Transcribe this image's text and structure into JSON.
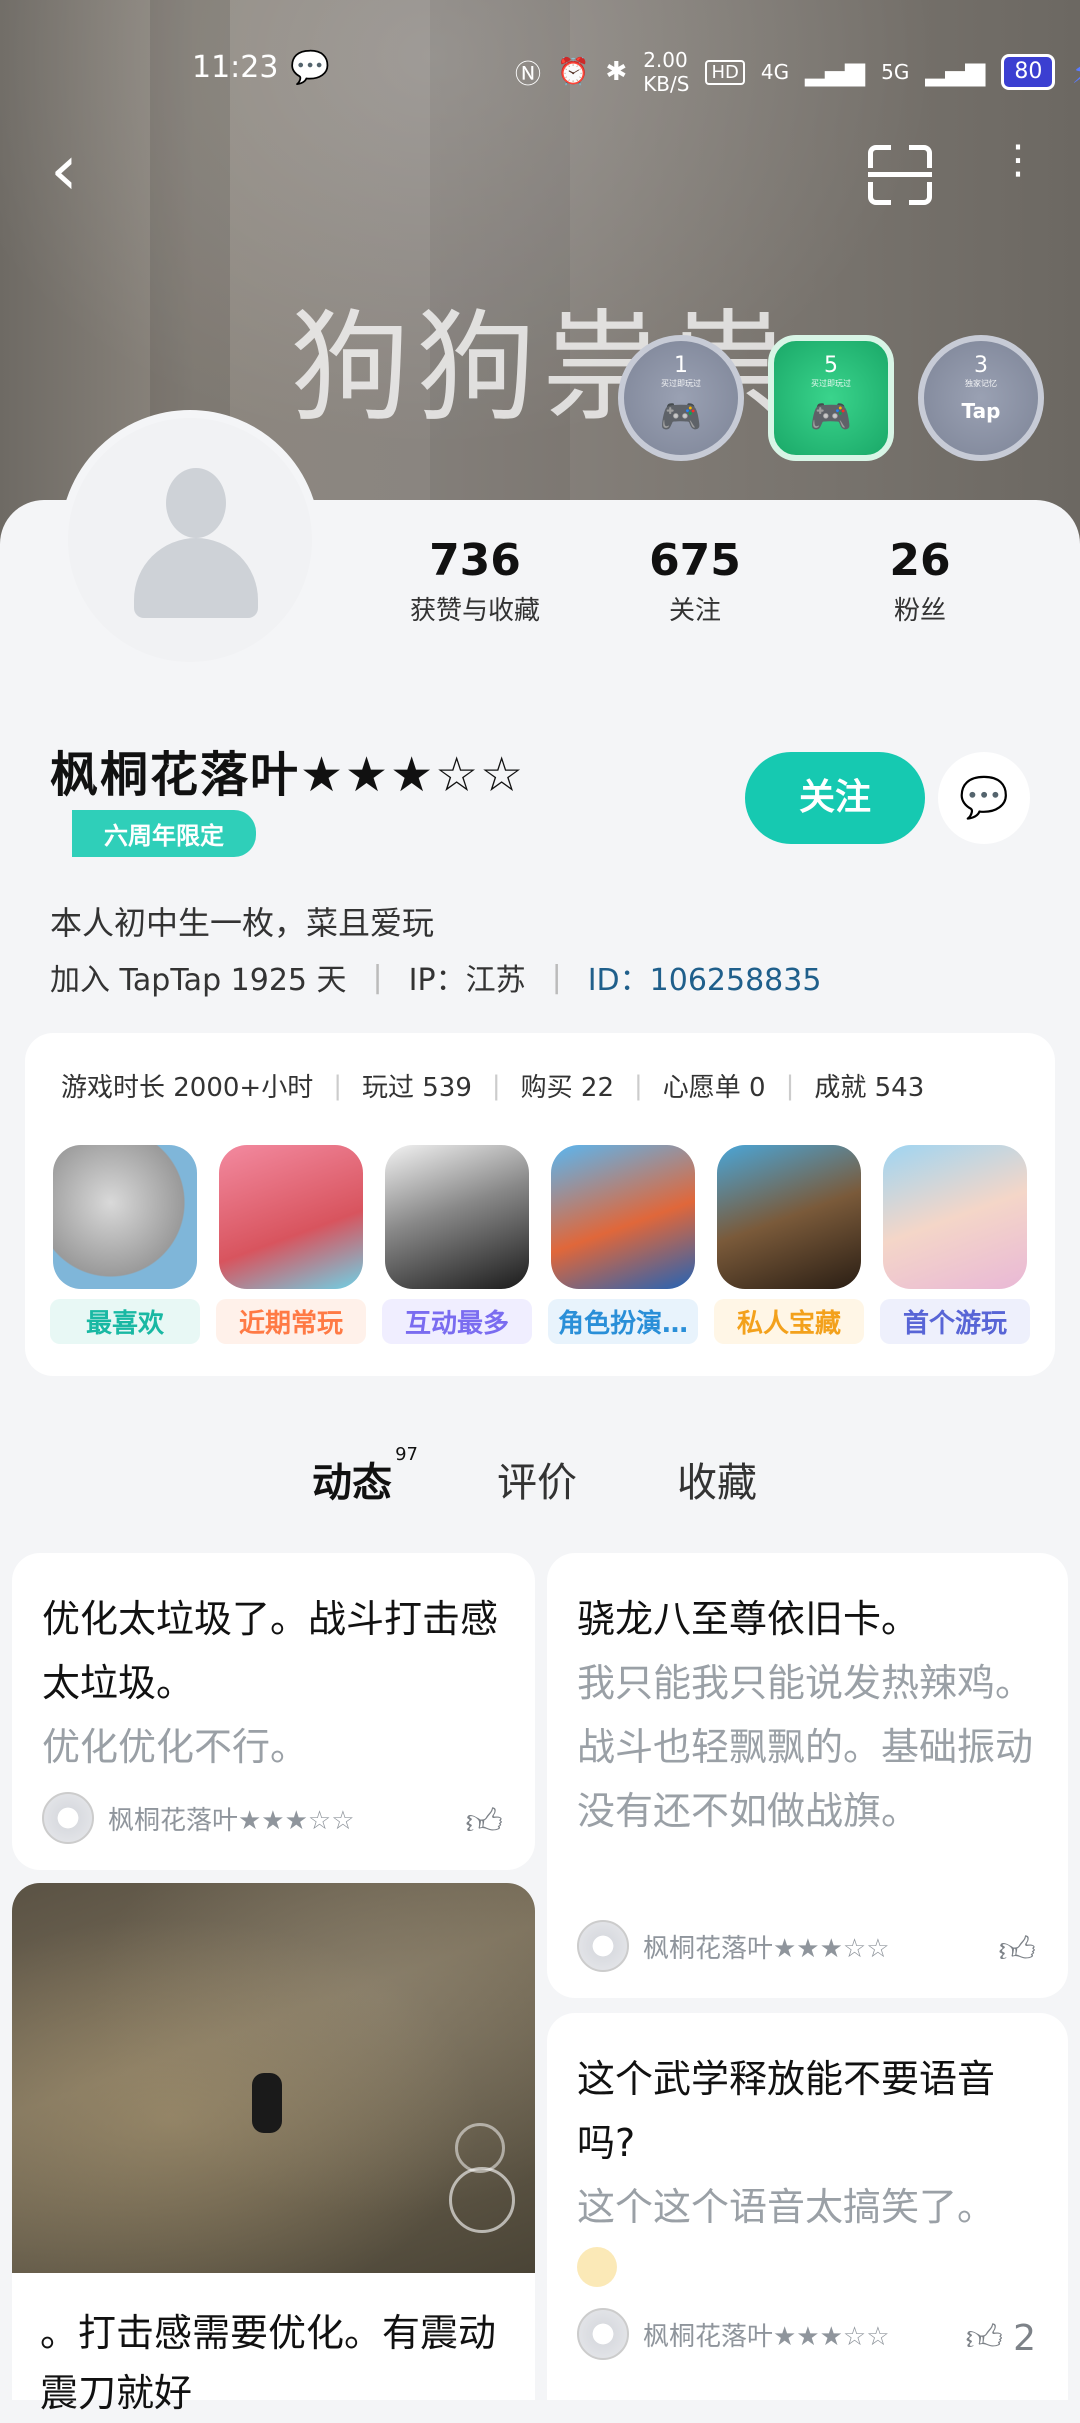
{
  "status_bar": {
    "time": "11:23",
    "network_speed": "2.00 KB/S",
    "hd_label": "HD",
    "signal_4g": "4G",
    "signal_5g": "5G",
    "battery": "80",
    "icons": [
      "wechat-icon",
      "nfc-icon",
      "alarm-icon",
      "bluetooth-icon",
      "signal-icon",
      "battery-icon",
      "charging-icon"
    ]
  },
  "banner": {
    "overlay_text": "狗狗祟祟"
  },
  "badges": [
    {
      "num": "1",
      "label": "买过即玩过",
      "color": "#8a90a3"
    },
    {
      "num": "5",
      "label": "买过即玩过",
      "color": "#22b574"
    },
    {
      "num": "3",
      "label": "独家记忆",
      "color": "#8a90a3",
      "tap": "Tap"
    }
  ],
  "profile": {
    "stats": [
      {
        "value": "736",
        "label": "获赞与收藏"
      },
      {
        "value": "675",
        "label": "关注"
      },
      {
        "value": "26",
        "label": "粉丝"
      }
    ],
    "name": "枫桐花落叶★★★☆☆",
    "tag": "六周年限定",
    "follow_label": "关注",
    "bio": "本人初中生一枚，菜且爱玩",
    "join": "加入 TapTap 1925 天",
    "ip": "IP：江苏",
    "id": "ID：106258835"
  },
  "game_stats": {
    "items": [
      "游戏时长 2000+小时",
      "玩过 539",
      "购买 22",
      "心愿单 0",
      "成就 543"
    ],
    "games": [
      {
        "label": "最喜欢",
        "color": "#19b8a3",
        "bg": "#e8f8f5"
      },
      {
        "label": "近期常玩",
        "color": "#ff7a45",
        "bg": "#fff1ea"
      },
      {
        "label": "互动最多",
        "color": "#7a6cf0",
        "bg": "#f0eeff"
      },
      {
        "label": "角色扮演…",
        "color": "#2a8fd8",
        "bg": "#e8f3fc"
      },
      {
        "label": "私人宝藏",
        "color": "#f3a11c",
        "bg": "#fff6e6"
      },
      {
        "label": "首个游玩",
        "color": "#5865d6",
        "bg": "#eef0fc"
      }
    ]
  },
  "tabs": [
    {
      "label": "动态",
      "count": "97",
      "active": true
    },
    {
      "label": "评价",
      "active": false
    },
    {
      "label": "收藏",
      "active": false
    }
  ],
  "posts": [
    {
      "title": "优化太垃圾了。战斗打击感太垃圾。",
      "body": "优化优化不行。",
      "author": "枫桐花落叶★★★☆☆",
      "likes": ""
    },
    {
      "title": "骁龙八至尊依旧卡。",
      "body": "我只能我只能说发热辣鸡。战斗也轻飘飘的。基础振动没有还不如做战旗。",
      "author": "枫桐花落叶★★★☆☆",
      "likes": ""
    },
    {
      "title": "这个武学释放能不要语音吗?",
      "body": "这个这个语音太搞笑了。",
      "author": "枫桐花落叶★★★☆☆",
      "likes": "2"
    },
    {
      "title": "。打击感需要优化。有震动震刀就好"
    }
  ]
}
